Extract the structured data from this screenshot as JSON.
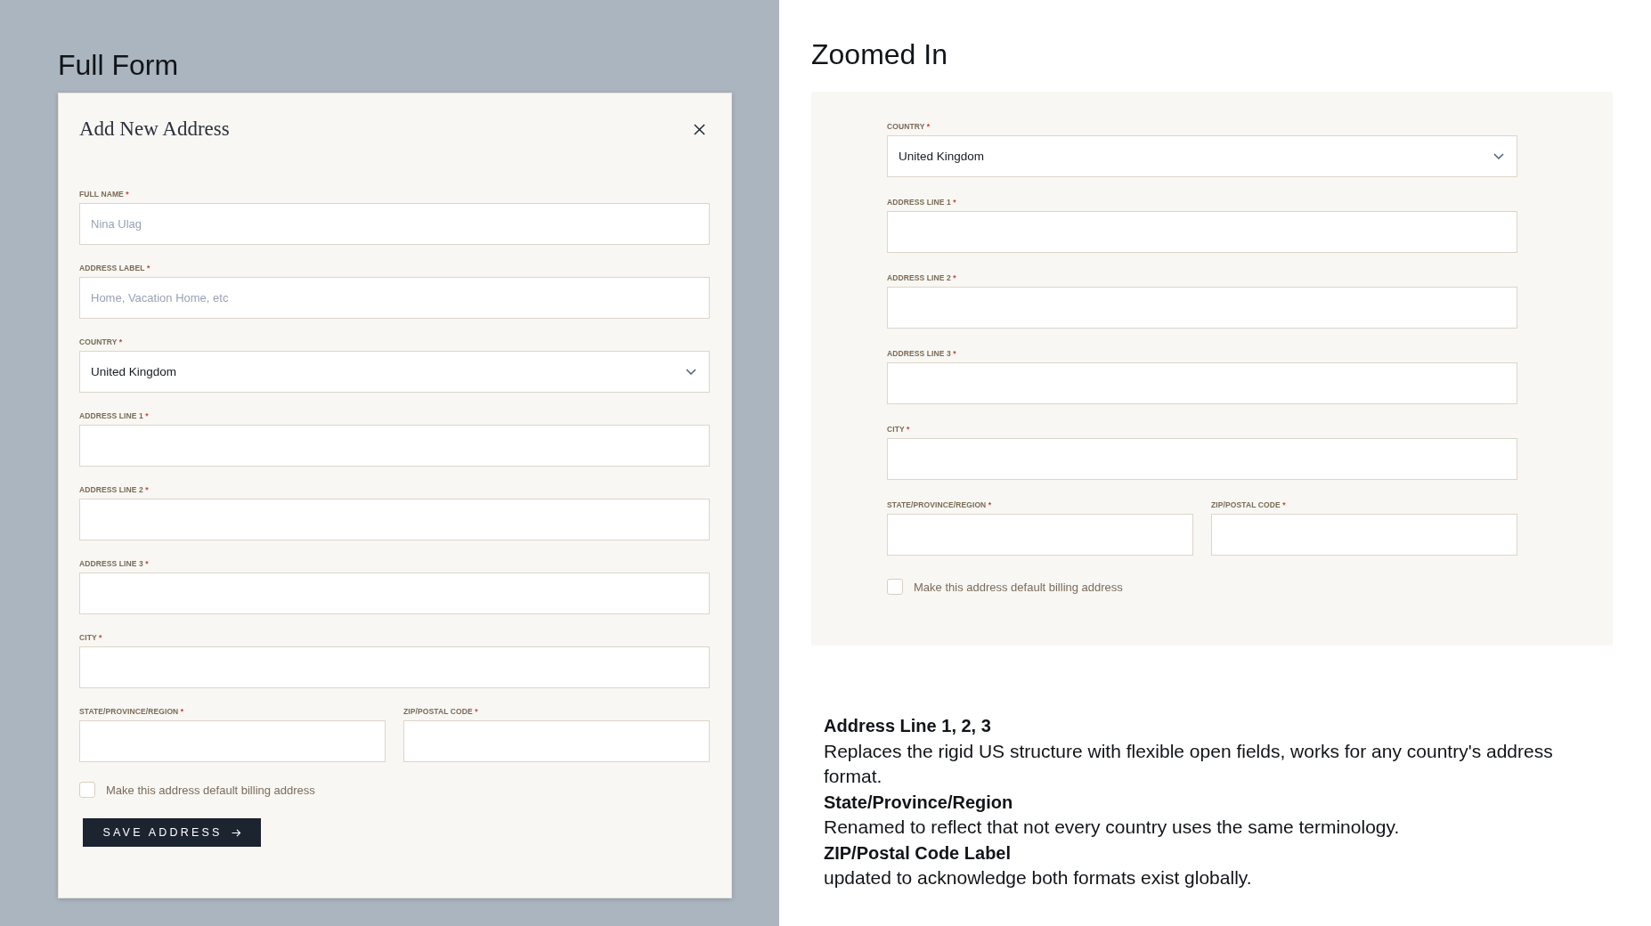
{
  "full_form": {
    "heading": "Full Form",
    "dialog": {
      "title": "Add New Address",
      "rows": [
        [
          {
            "label": "FULL NAME",
            "required_mark": "*",
            "kind": "text",
            "placeholder": "Nina Ulag"
          }
        ],
        [
          {
            "label": "ADDRESS LABEL",
            "required_mark": "*",
            "kind": "text",
            "placeholder": "Home, Vacation Home, etc"
          }
        ],
        [
          {
            "label": "COUNTRY",
            "required_mark": "*",
            "kind": "select",
            "value": "United Kingdom"
          }
        ],
        [
          {
            "label": "ADDRESS LINE 1",
            "required_mark": "*",
            "kind": "text"
          }
        ],
        [
          {
            "label": "ADDRESS LINE 2",
            "required_mark": "*",
            "kind": "text"
          }
        ],
        [
          {
            "label": "ADDRESS LINE 3",
            "required_mark": "*",
            "kind": "text"
          }
        ],
        [
          {
            "label": "CITY",
            "required_mark": "*",
            "kind": "text"
          }
        ],
        [
          {
            "label": "STATE/PROVINCE/REGION",
            "required_mark": "*",
            "kind": "text"
          },
          {
            "label": "ZIP/POSTAL CODE",
            "required_mark": "*",
            "kind": "text"
          }
        ]
      ],
      "default_billing": {
        "label": "Make this address default billing address",
        "checked": false
      },
      "save_button": "SAVE ADDRESS"
    }
  },
  "zoomed_in": {
    "heading": "Zoomed In",
    "form": {
      "rows": [
        [
          {
            "label": "COUNTRY",
            "required_mark": "*",
            "kind": "select",
            "value": "United Kingdom"
          }
        ],
        [
          {
            "label": "ADDRESS LINE 1",
            "required_mark": "*",
            "kind": "text"
          }
        ],
        [
          {
            "label": "ADDRESS LINE 2",
            "required_mark": "*",
            "kind": "text"
          }
        ],
        [
          {
            "label": "ADDRESS LINE 3",
            "required_mark": "*",
            "kind": "text"
          }
        ],
        [
          {
            "label": "CITY",
            "required_mark": "*",
            "kind": "text"
          }
        ],
        [
          {
            "label": "STATE/PROVINCE/REGION",
            "required_mark": "*",
            "kind": "text"
          },
          {
            "label": "ZIP/POSTAL CODE",
            "required_mark": "*",
            "kind": "text"
          }
        ]
      ],
      "default_billing": {
        "label": "Make this address default billing address",
        "checked": false
      }
    }
  },
  "notes": [
    {
      "title": "Address Line 1, 2, 3",
      "text": "Replaces the rigid US structure with flexible open fields, works for any country's address format."
    },
    {
      "title": "State/Province/Region",
      "text": "Renamed to reflect that not every country uses the same terminology."
    },
    {
      "title": "ZIP/Postal Code Label",
      "text": "updated to acknowledge both formats exist globally."
    }
  ]
}
